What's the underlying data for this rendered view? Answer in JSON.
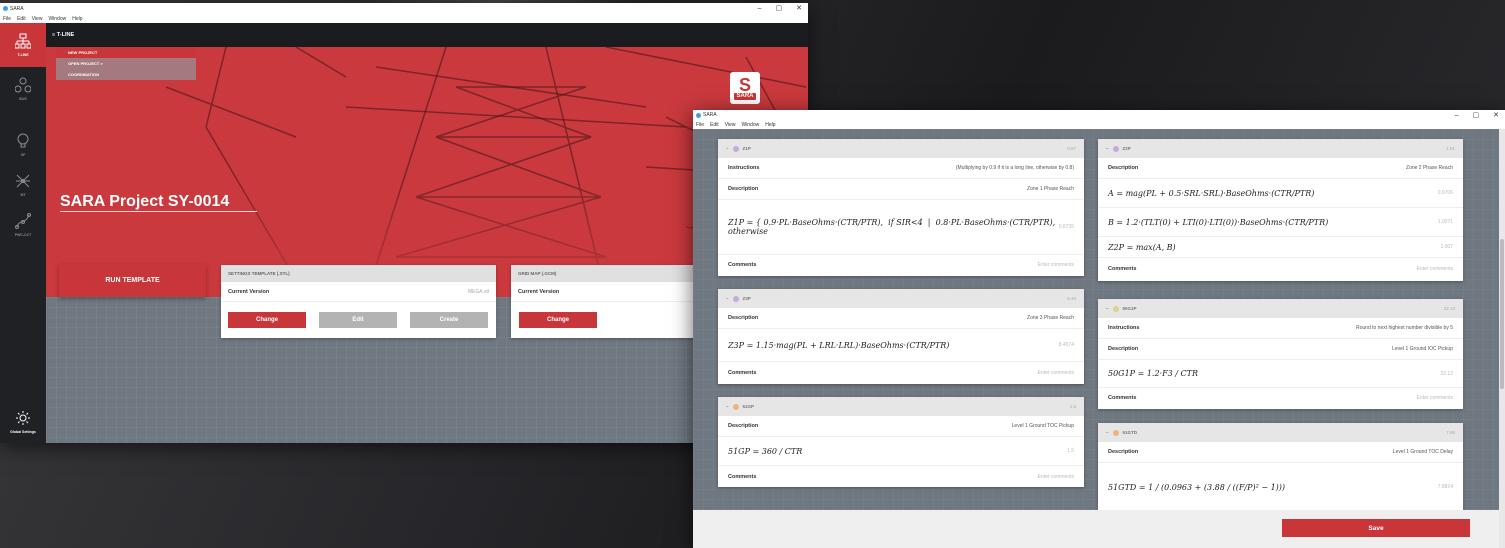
{
  "app": {
    "title": "SARA",
    "menu": [
      "File",
      "Edit",
      "View",
      "Window",
      "Help"
    ]
  },
  "sidebar": [
    {
      "label": "T-LINE",
      "icon": "network-icon"
    },
    {
      "label": "BUS",
      "icon": "bus-icon"
    },
    {
      "label": "XF",
      "icon": "bulb-icon"
    },
    {
      "label": "MT",
      "icon": "star-network-icon"
    },
    {
      "label": "PWC-CCT",
      "icon": "curve-icon"
    },
    {
      "label": "Global Settings",
      "icon": "gear-icon"
    }
  ],
  "topnav": {
    "title": "≡ T-LINE"
  },
  "dropdown": [
    "NEW PROJECT",
    "OPEN PROJECT >",
    "COORDINATION"
  ],
  "logo": {
    "letter": "S",
    "text": "SARA"
  },
  "project_title": "SARA Project SY-0014",
  "run_button": "RUN TEMPLATE",
  "settings_card": {
    "header": "SETTINGS TEMPLATE (.STL)",
    "label": "Current Version",
    "value": "MEGA.stl",
    "buttons": [
      "Change",
      "Edit",
      "Create"
    ]
  },
  "grid_card": {
    "header": "GRID MAP (.GCM)",
    "label": "Current Version",
    "button": "Change"
  },
  "colors": {
    "accent": "#c8363a",
    "purple": "#c8a9e0",
    "yellow": "#e0d08a",
    "orange": "#f0b27a"
  },
  "formulas": {
    "z1p": {
      "name": "Z1P",
      "value": "0.87",
      "instructions": "(Multiplying by 0.9 if it is a long line, otherwise by 0.8)",
      "description": "Zone 1 Phase Reach",
      "result": "0.8735",
      "comments_ph": "Enter comments"
    },
    "z2p": {
      "name": "Z2P",
      "value": "1.01",
      "description": "Zone 2 Phase Reach",
      "results": [
        "0.9706",
        "1.0071",
        "1.007"
      ],
      "comments_ph": "Enter comments"
    },
    "z3p": {
      "name": "Z3P",
      "value": "8.46",
      "description": "Zone 3 Phase Reach",
      "result": "8.4574",
      "comments_ph": "Enter comments"
    },
    "g50g1p": {
      "name": "50G1P",
      "value": "22.13",
      "instructions": "Round to next highest number divisible by 5",
      "description": "Level 1 Ground IOC Pickup",
      "result": "22.12",
      "comments_ph": "Enter comments"
    },
    "g51gp": {
      "name": "51GP",
      "value": "1.5",
      "description": "Level 1 Ground TOC Pickup",
      "result": "1.5",
      "comments_ph": "Enter comments"
    },
    "g51gtd": {
      "name": "51GTD",
      "value": "7.88",
      "description": "Level 1 Ground TOC Delay",
      "result": "7.8824"
    }
  },
  "labels": {
    "instructions": "Instructions",
    "description": "Description",
    "comments": "Comments"
  },
  "save_button": "Save"
}
